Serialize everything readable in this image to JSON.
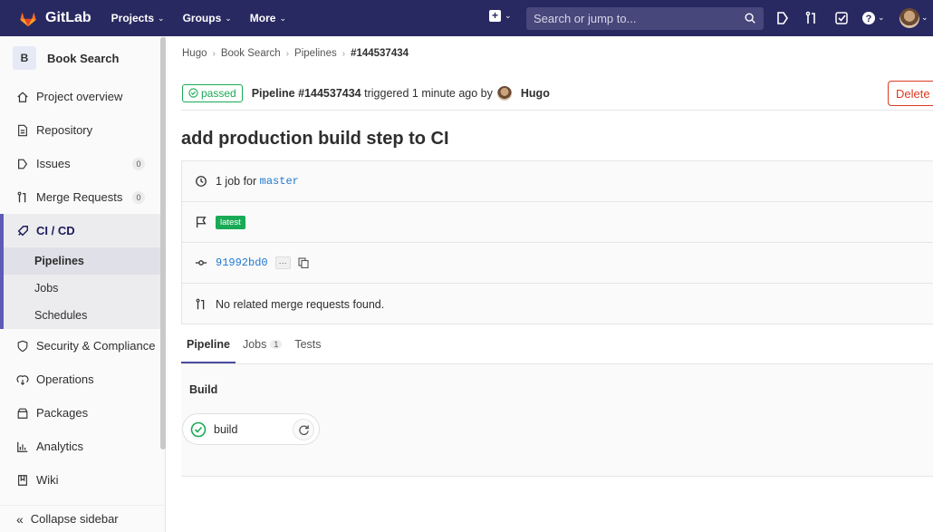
{
  "navbar": {
    "brand": "GitLab",
    "links": [
      "Projects",
      "Groups",
      "More"
    ],
    "search_placeholder": "Search or jump to...",
    "icons": [
      "plus-square-icon",
      "search-icon",
      "issues-icon",
      "merge-request-icon",
      "todo-icon",
      "help-icon",
      "user-avatar"
    ]
  },
  "sidebar": {
    "project_letter": "B",
    "project_name": "Book Search",
    "items": [
      {
        "label": "Project overview",
        "icon": "home-icon"
      },
      {
        "label": "Repository",
        "icon": "doc-icon"
      },
      {
        "label": "Issues",
        "icon": "issues-icon",
        "count": "0"
      },
      {
        "label": "Merge Requests",
        "icon": "merge-request-icon",
        "count": "0"
      },
      {
        "label": "CI / CD",
        "icon": "rocket-icon"
      },
      {
        "label": "Security & Compliance",
        "icon": "shield-icon"
      },
      {
        "label": "Operations",
        "icon": "cloud-icon"
      },
      {
        "label": "Packages",
        "icon": "package-icon"
      },
      {
        "label": "Analytics",
        "icon": "chart-icon"
      },
      {
        "label": "Wiki",
        "icon": "book-icon"
      }
    ],
    "cicd_sub": [
      "Pipelines",
      "Jobs",
      "Schedules"
    ],
    "collapse": "Collapse sidebar"
  },
  "breadcrumb": [
    "Hugo",
    "Book Search",
    "Pipelines",
    "#144537434"
  ],
  "header": {
    "status": "passed",
    "pipeline": "Pipeline #144537434",
    "triggered": "triggered 1 minute ago by",
    "user": "Hugo",
    "delete": "Delete"
  },
  "title": "add production build step to CI",
  "info": {
    "jobs_text": "1 job for",
    "branch": "master",
    "latest": "latest",
    "commit": "91992bd0",
    "ellipsis": "···",
    "mr_text": "No related merge requests found."
  },
  "tabs": [
    {
      "label": "Pipeline",
      "active": true
    },
    {
      "label": "Jobs",
      "count": "1"
    },
    {
      "label": "Tests"
    }
  ],
  "stage": {
    "name": "Build",
    "job": "build"
  },
  "colors": {
    "navbar": "#292961",
    "success": "#1aaa55",
    "danger": "#db3b21",
    "link": "#1f78d1"
  }
}
